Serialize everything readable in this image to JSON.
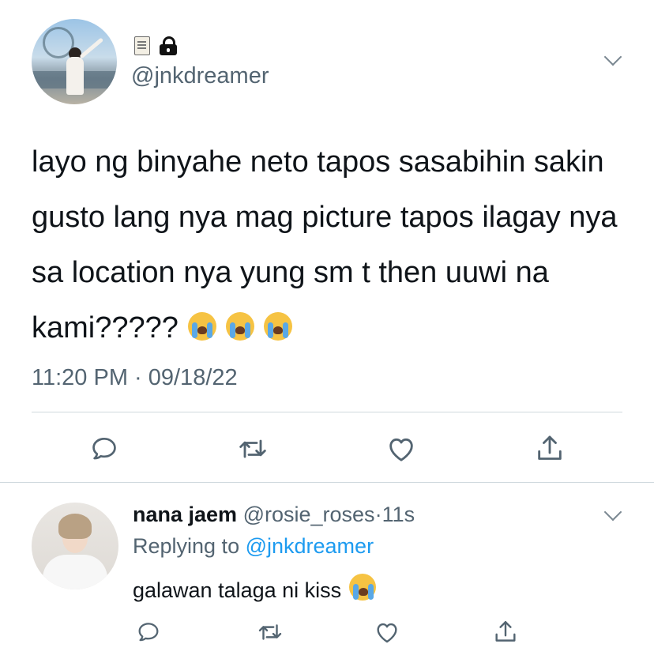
{
  "main_tweet": {
    "handle": "@jnkdreamer",
    "text": "layo ng binyahe neto tapos sasabihin sakin gusto lang nya mag picture tapos ilagay nya sa location nya yung sm t then uuwi na kami?????",
    "text_emojis": [
      "loudly-crying-face",
      "loudly-crying-face",
      "loudly-crying-face"
    ],
    "timestamp": "11:20 PM · 09/18/22",
    "name_icons": [
      "scroll-icon",
      "lock-icon"
    ],
    "actions": [
      "reply-icon",
      "retweet-icon",
      "like-icon",
      "share-icon"
    ]
  },
  "reply": {
    "name": "nana jaem",
    "handle": "@rosie_roses",
    "separator": "·",
    "time": "11s",
    "replying_prefix": "Replying to ",
    "replying_to": "@jnkdreamer",
    "text": "galawan talaga ni kiss",
    "text_emoji": "loudly-crying-face",
    "actions": [
      "reply-icon",
      "retweet-icon",
      "like-icon",
      "share-icon"
    ]
  },
  "colors": {
    "text": "#0f1419",
    "secondary": "#536471",
    "link": "#1d9bf0",
    "divider": "#cfd9de"
  }
}
